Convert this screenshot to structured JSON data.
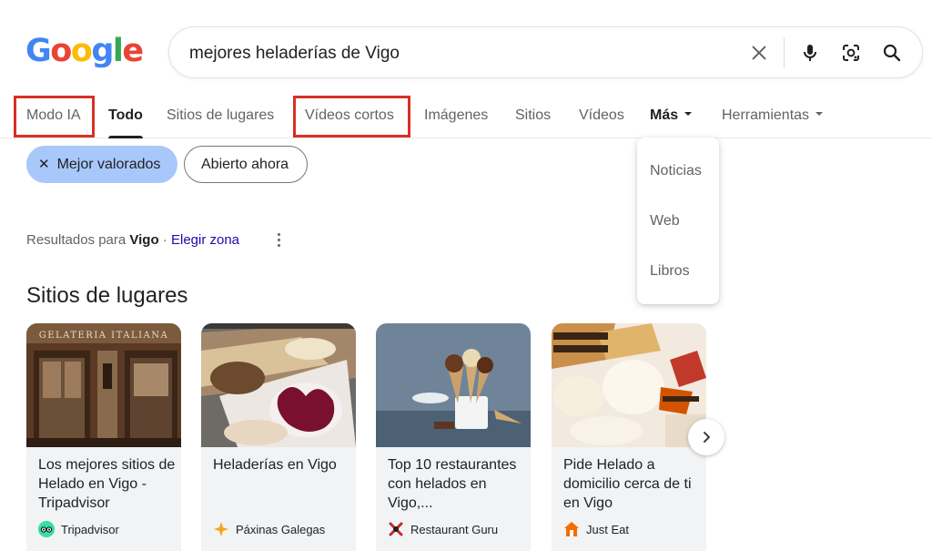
{
  "logo": {
    "text": "Google",
    "letters": [
      "G",
      "o",
      "o",
      "g",
      "l",
      "e"
    ],
    "colors": [
      "#4285f4",
      "#ea4335",
      "#fbbc05",
      "#4285f4",
      "#34a853",
      "#ea4335"
    ]
  },
  "search": {
    "query": "mejores heladerías de Vigo",
    "icons": [
      "close-icon",
      "mic-icon",
      "lens-icon",
      "search-icon"
    ]
  },
  "tabs": [
    {
      "label": "Modo IA"
    },
    {
      "label": "Todo"
    },
    {
      "label": "Sitios de lugares"
    },
    {
      "label": "Vídeos cortos"
    },
    {
      "label": "Imágenes"
    },
    {
      "label": "Sitios"
    },
    {
      "label": "Vídeos"
    },
    {
      "label": "Más"
    },
    {
      "label": "Herramientas"
    }
  ],
  "highlight_color": "#d93025",
  "chips": {
    "active": "Mejor valorados",
    "inactive": "Abierto ahora",
    "active_color": "#a8c7fa"
  },
  "more_menu": {
    "items": [
      "Noticias",
      "Web",
      "Libros"
    ]
  },
  "results_for": {
    "prefix": "Resultados para",
    "place": "Vigo",
    "separator": "·",
    "link": "Elegir zona"
  },
  "section_title": "Sitios de lugares",
  "cards": [
    {
      "title": "Los mejores sitios de Helado en Vigo - Tripadvisor",
      "source": "Tripadvisor",
      "shop_sign": "GELATERIA ITALIANA"
    },
    {
      "title": "Heladerías en Vigo",
      "source": "Páxinas Galegas"
    },
    {
      "title": "Top 10 restaurantes con helados en Vigo,...",
      "source": "Restaurant Guru"
    },
    {
      "title": "Pide Helado a domicilio cerca de ti en Vigo",
      "source": "Just Eat"
    }
  ],
  "next_icon": "chevron-right-icon"
}
